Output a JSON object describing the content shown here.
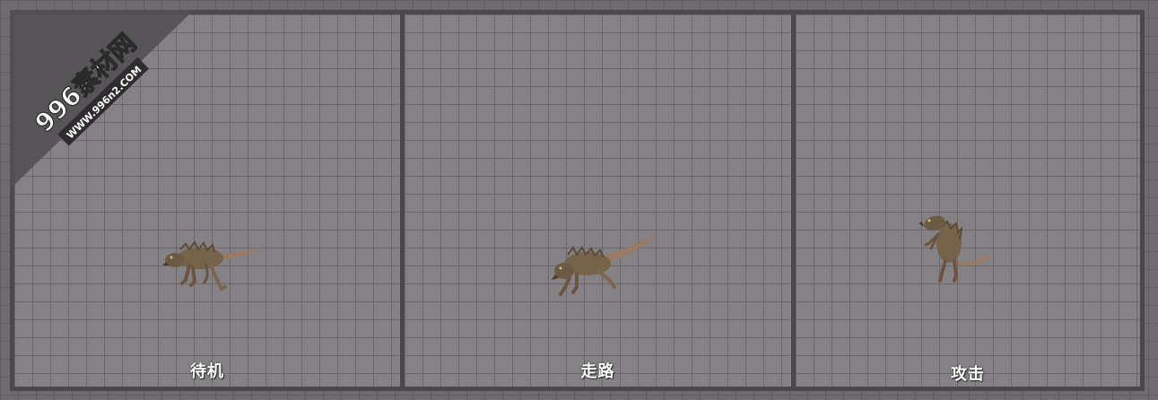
{
  "watermark": {
    "brand": "996素材网",
    "url": "WWW.996n2.COM"
  },
  "panels": [
    {
      "label": "待机",
      "icon": "rat-monster-idle"
    },
    {
      "label": "走路",
      "icon": "rat-monster-walk"
    },
    {
      "label": "攻击",
      "icon": "rat-monster-attack"
    }
  ],
  "colors": {
    "background": "#6f6c6f",
    "panel": "#858285",
    "frame": "#4b484b",
    "label": "#ffffff",
    "creature_body": "#7a6548"
  }
}
